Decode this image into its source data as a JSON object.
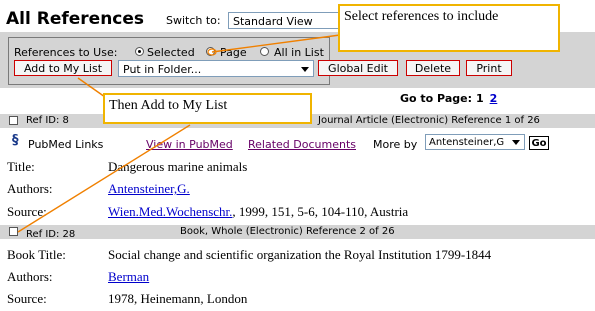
{
  "header": {
    "title": "All References",
    "switch_label": "Switch to:",
    "view_value": "Standard View"
  },
  "options": {
    "refs_label": "References to Use:",
    "radio_selected": "Selected",
    "radio_page": "Page",
    "radio_all": "All in List"
  },
  "toolbar": {
    "add_to_list": "Add to My List",
    "folder_placeholder": "Put in Folder...",
    "global_edit": "Global Edit",
    "delete": "Delete",
    "print": "Print"
  },
  "pagination": {
    "label": "Go to Page:",
    "current": "1",
    "next": "2"
  },
  "references": [
    {
      "ref_id": "Ref ID: 8",
      "type_info": "Journal Article (Electronic) Reference 1 of 26",
      "pubmed_label": "PubMed Links",
      "view_pubmed": "View in PubMed",
      "related": "Related Documents",
      "more_by": "More by",
      "more_by_value": "Antensteiner,G",
      "go": "Go",
      "title_label": "Title:",
      "title_value": "Dangerous marine animals",
      "authors_label": "Authors:",
      "authors_value": "Antensteiner,G.",
      "source_label": "Source:",
      "source_journal": "Wien.Med.Wochenschr.",
      "source_rest": ", 1999, 151, 5-6, 104-110, Austria"
    },
    {
      "ref_id": "Ref ID: 28",
      "type_info": "Book, Whole (Electronic) Reference 2 of 26",
      "title_label": "Book Title:",
      "title_value": "Social change and scientific organization the Royal Institution 1799-1844",
      "authors_label": "Authors:",
      "authors_value": "Berman",
      "source_label": "Source:",
      "source_value": "1978, Heinemann, London"
    }
  ],
  "callouts": {
    "select": "Select references to include",
    "add": "Then Add to My List"
  },
  "colors": {
    "callout_border": "#f0b400",
    "arrow": "#f08000",
    "button_border": "#cc0000",
    "link": "#0000cc"
  }
}
